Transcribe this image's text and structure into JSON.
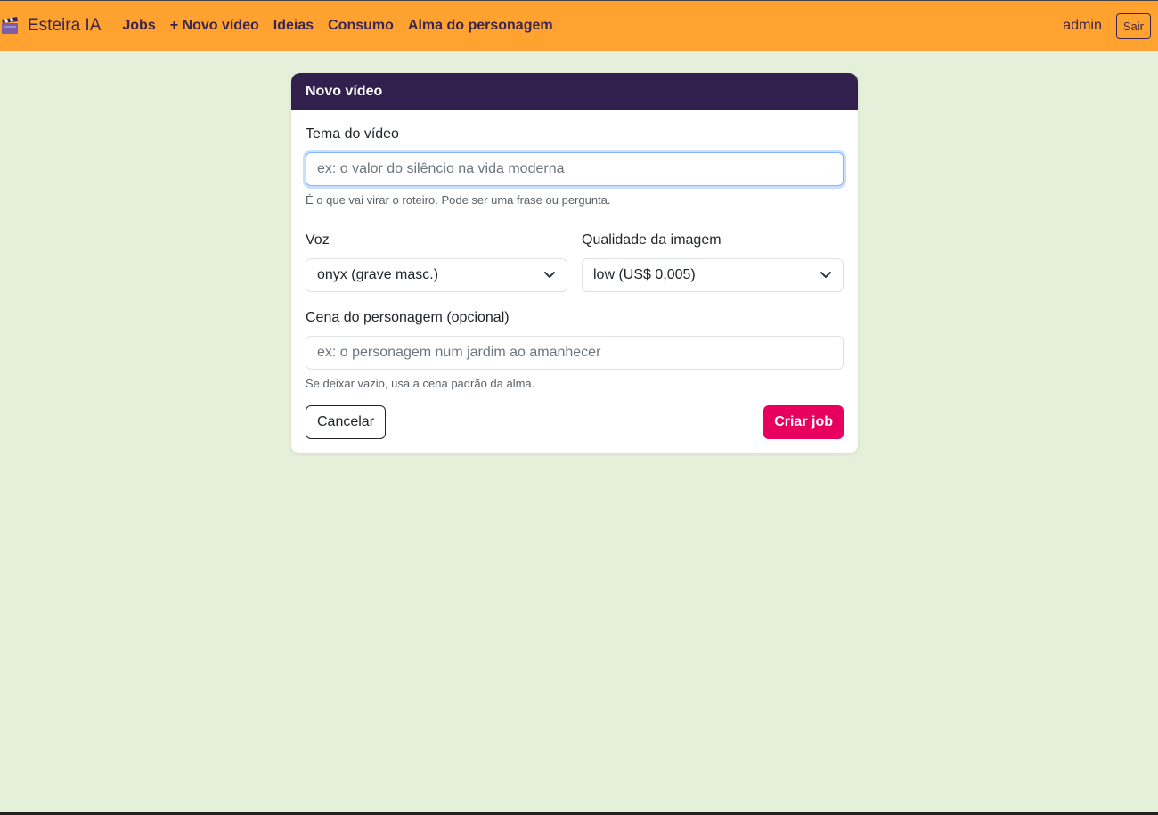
{
  "navbar": {
    "brand": "Esteira IA",
    "brand_icon": "clapperboard-icon",
    "links": [
      "Jobs",
      "+ Novo vídeo",
      "Ideias",
      "Consumo",
      "Alma do personagem"
    ],
    "user": "admin",
    "logout_label": "Sair"
  },
  "form": {
    "header_title": "Novo vídeo",
    "theme": {
      "label": "Tema do vídeo",
      "placeholder": "ex: o valor do silêncio na vida moderna",
      "value": "",
      "help": "É o que vai virar o roteiro. Pode ser uma frase ou pergunta."
    },
    "voice": {
      "label": "Voz",
      "selected": "onyx (grave masc.)"
    },
    "quality": {
      "label": "Qualidade da imagem",
      "selected": "low (US$ 0,005)"
    },
    "scene": {
      "label": "Cena do personagem (opcional)",
      "placeholder": "ex: o personagem num jardim ao amanhecer",
      "value": "",
      "help": "Se deixar vazio, usa a cena padrão da alma."
    },
    "cancel_label": "Cancelar",
    "submit_label": "Criar job"
  },
  "colors": {
    "navbar": "#ffa230",
    "card_header": "#31204d",
    "submit": "#e8005f",
    "background": "#e5f0da"
  }
}
